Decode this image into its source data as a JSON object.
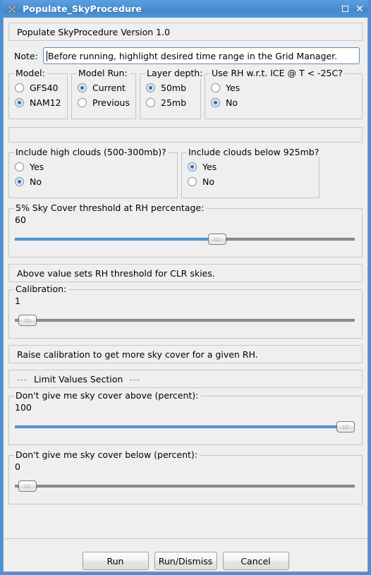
{
  "window": {
    "title": "Populate_SkyProcedure",
    "app_icon": "x-cross-icon",
    "controls": [
      {
        "name": "maximize",
        "icon": "maximize-icon"
      },
      {
        "name": "close",
        "icon": "close-icon"
      }
    ],
    "accent_color": "#4a90d9",
    "background_color": "#efefef"
  },
  "version_banner": "Populate SkyProcedure Version 1.0",
  "note": {
    "label": "Note:",
    "value": "Before running, highlight desired time range in the Grid Manager."
  },
  "option_groups": [
    {
      "legend": "Model:",
      "options": [
        {
          "label": "GFS40",
          "selected": false
        },
        {
          "label": "NAM12",
          "selected": true
        }
      ]
    },
    {
      "legend": "Model Run:",
      "options": [
        {
          "label": "Current",
          "selected": true
        },
        {
          "label": "Previous",
          "selected": false
        }
      ]
    },
    {
      "legend": "Layer depth:",
      "options": [
        {
          "label": "50mb",
          "selected": true
        },
        {
          "label": "25mb",
          "selected": false
        }
      ]
    },
    {
      "legend": "Use RH w.r.t. ICE @ T < -25C?",
      "options": [
        {
          "label": "Yes",
          "selected": false
        },
        {
          "label": "No",
          "selected": true
        }
      ]
    }
  ],
  "spacer_panel": "",
  "cloud_groups": [
    {
      "legend": "Include high clouds (500-300mb)?",
      "options": [
        {
          "label": "Yes",
          "selected": false
        },
        {
          "label": "No",
          "selected": true
        }
      ]
    },
    {
      "legend": "Include clouds below 925mb?",
      "options": [
        {
          "label": "Yes",
          "selected": true
        },
        {
          "label": "No",
          "selected": false
        }
      ]
    }
  ],
  "sky_cover_threshold": {
    "legend": "5% Sky Cover threshold at RH percentage:",
    "value": "60",
    "percent": 60
  },
  "sky_cover_note": "Above value sets RH threshold for CLR skies.",
  "calibration": {
    "legend": "Calibration:",
    "value": "1",
    "percent": 1
  },
  "calibration_note": "Raise calibration to get more sky cover for a given RH.",
  "limit_section": {
    "dash_left": "---",
    "title": "Limit Values Section",
    "dash_right": "---"
  },
  "sky_cover_above": {
    "legend": "Don't give me sky cover above (percent):",
    "value": "100",
    "percent": 100
  },
  "sky_cover_below": {
    "legend": "Don't give me sky cover below (percent):",
    "value": "0",
    "percent": 1
  },
  "buttons": [
    {
      "label": "Run",
      "name": "run-button"
    },
    {
      "label": "Run/Dismiss",
      "name": "run-dismiss-button"
    },
    {
      "label": "Cancel",
      "name": "cancel-button"
    }
  ]
}
